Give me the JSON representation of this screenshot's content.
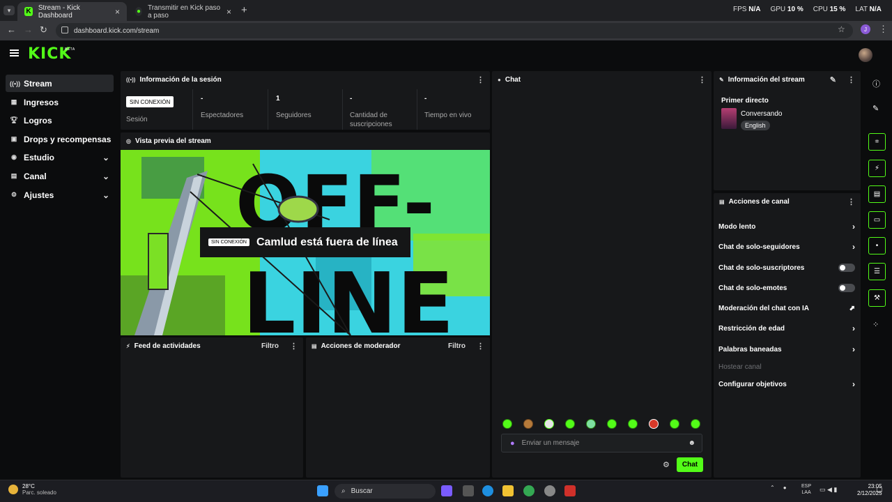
{
  "browser": {
    "tabs": [
      {
        "title": "Stream - Kick Dashboard",
        "active": true
      },
      {
        "title": "Transmitir en Kick paso a paso",
        "active": false
      }
    ],
    "url": "dashboard.kick.com/stream",
    "perf": {
      "fps_label": "FPS",
      "fps": "N/A",
      "gpu_label": "GPU",
      "gpu": "10 %",
      "cpu_label": "CPU",
      "cpu": "15 %",
      "lat_label": "LAT",
      "lat": "N/A"
    },
    "profile_initial": "J"
  },
  "header": {
    "logo": "KICK",
    "beta": "BETA"
  },
  "sidebar": {
    "items": [
      {
        "label": "Stream",
        "icon": "broadcast-icon"
      },
      {
        "label": "Ingresos",
        "icon": "bar-chart-icon"
      },
      {
        "label": "Logros",
        "icon": "trophy-icon"
      },
      {
        "label": "Drops y recompensas",
        "icon": "gift-icon"
      },
      {
        "label": "Estudio",
        "icon": "studio-icon"
      },
      {
        "label": "Canal",
        "icon": "grid-icon"
      },
      {
        "label": "Ajustes",
        "icon": "gear-icon"
      }
    ]
  },
  "session": {
    "title": "Información de la sesión",
    "badge": "SIN CONEXIÓN",
    "stats": [
      {
        "value": "",
        "label": "Sesión"
      },
      {
        "value": "-",
        "label": "Espectadores"
      },
      {
        "value": "1",
        "label": "Seguidores"
      },
      {
        "value": "-",
        "label": "Cantidad de suscripciones"
      },
      {
        "value": "-",
        "label": "Tiempo en vivo"
      }
    ]
  },
  "preview": {
    "title": "Vista previa del stream",
    "badge": "SIN CONEXIÓN",
    "message": "Camlud está fuera de línea",
    "art_line1": "OFF-",
    "art_line2": "LINE"
  },
  "activity": {
    "title": "Feed de actividades",
    "filter": "Filtro"
  },
  "moderator": {
    "title": "Acciones de moderador",
    "filter": "Filtro"
  },
  "chat": {
    "title": "Chat",
    "placeholder": "Enviar un mensaje",
    "send": "Chat"
  },
  "stream_info": {
    "title": "Información del stream",
    "stream_title": "Primer directo",
    "category": "Conversando",
    "language": "English"
  },
  "channel_actions": {
    "title": "Acciones de canal",
    "items": [
      {
        "label": "Modo lento",
        "control": "chevron"
      },
      {
        "label": "Chat de solo-seguidores",
        "control": "chevron"
      },
      {
        "label": "Chat de solo-suscriptores",
        "control": "toggle-off"
      },
      {
        "label": "Chat de solo-emotes",
        "control": "toggle-off"
      },
      {
        "label": "Moderación del chat con IA",
        "control": "external"
      },
      {
        "label": "Restricción de edad",
        "control": "chevron"
      },
      {
        "label": "Palabras baneadas",
        "control": "chevron"
      },
      {
        "label": "Hostear canal",
        "control": "disabled"
      },
      {
        "label": "Configurar objetivos",
        "control": "chevron"
      }
    ]
  },
  "taskbar": {
    "weather_temp": "28°C",
    "weather_desc": "Parc. soleado",
    "search": "Buscar",
    "lang_1": "ESP",
    "lang_2": "LAA",
    "time": "23:05",
    "date": "2/12/2025"
  },
  "colors": {
    "accent": "#53fc18",
    "panel": "#17181a",
    "bg": "#0b0c0d"
  }
}
